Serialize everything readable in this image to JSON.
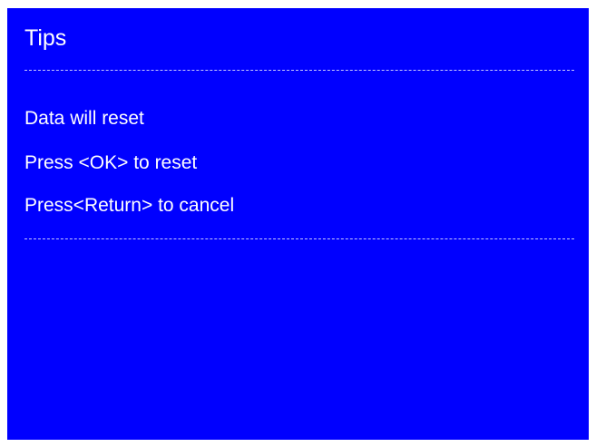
{
  "dialog": {
    "title": "Tips",
    "lines": [
      "Data will reset",
      "Press <OK> to reset",
      "Press<Return> to cancel"
    ]
  },
  "colors": {
    "background": "#0000ff",
    "text": "#ffffff"
  }
}
